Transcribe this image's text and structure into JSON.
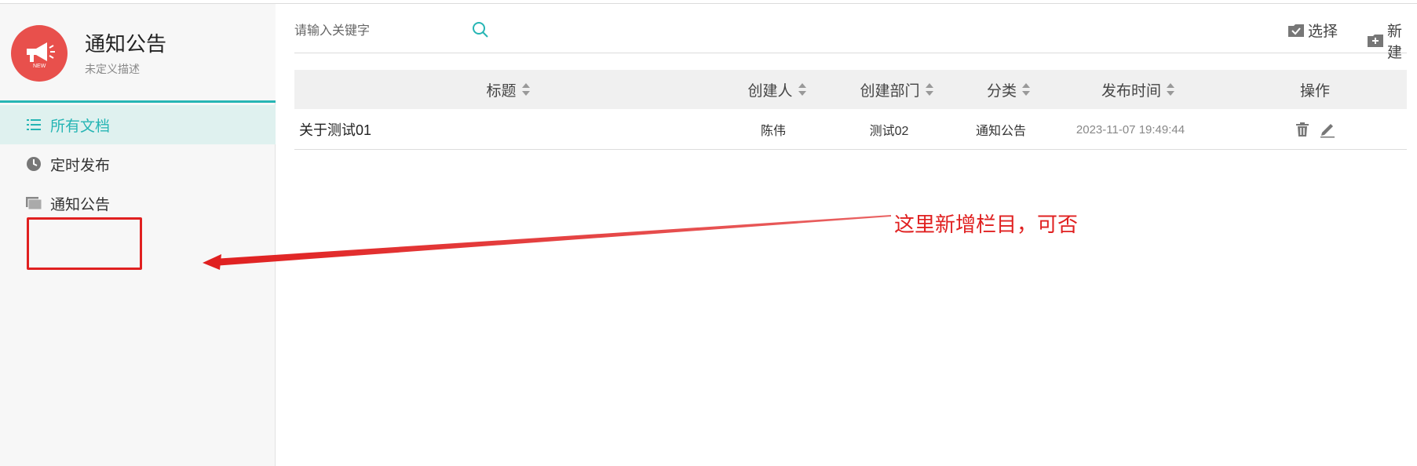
{
  "app": {
    "title": "通知公告",
    "description": "未定义描述",
    "logo_badge": "NEW"
  },
  "sidebar": {
    "items": [
      {
        "label": "所有文档",
        "icon": "list-icon",
        "active": true
      },
      {
        "label": "定时发布",
        "icon": "clock-icon",
        "active": false
      },
      {
        "label": "通知公告",
        "icon": "folder-icon",
        "active": false
      }
    ]
  },
  "toolbar": {
    "search_placeholder": "请输入关键字",
    "select_label": "选择",
    "new_label": "新建"
  },
  "table": {
    "columns": [
      {
        "label": "标题",
        "sortable": true
      },
      {
        "label": "创建人",
        "sortable": true
      },
      {
        "label": "创建部门",
        "sortable": true
      },
      {
        "label": "分类",
        "sortable": true
      },
      {
        "label": "发布时间",
        "sortable": true
      },
      {
        "label": "操作",
        "sortable": false
      }
    ],
    "rows": [
      {
        "title": "关于测试01",
        "creator": "陈伟",
        "department": "测试02",
        "category": "通知公告",
        "published": "2023-11-07 19:49:44"
      }
    ]
  },
  "annotation": {
    "text": "这里新增栏目，可否",
    "color": "#e02020"
  },
  "colors": {
    "accent": "#26b5b4",
    "logo": "#e8504c",
    "annotation": "#e02020"
  }
}
